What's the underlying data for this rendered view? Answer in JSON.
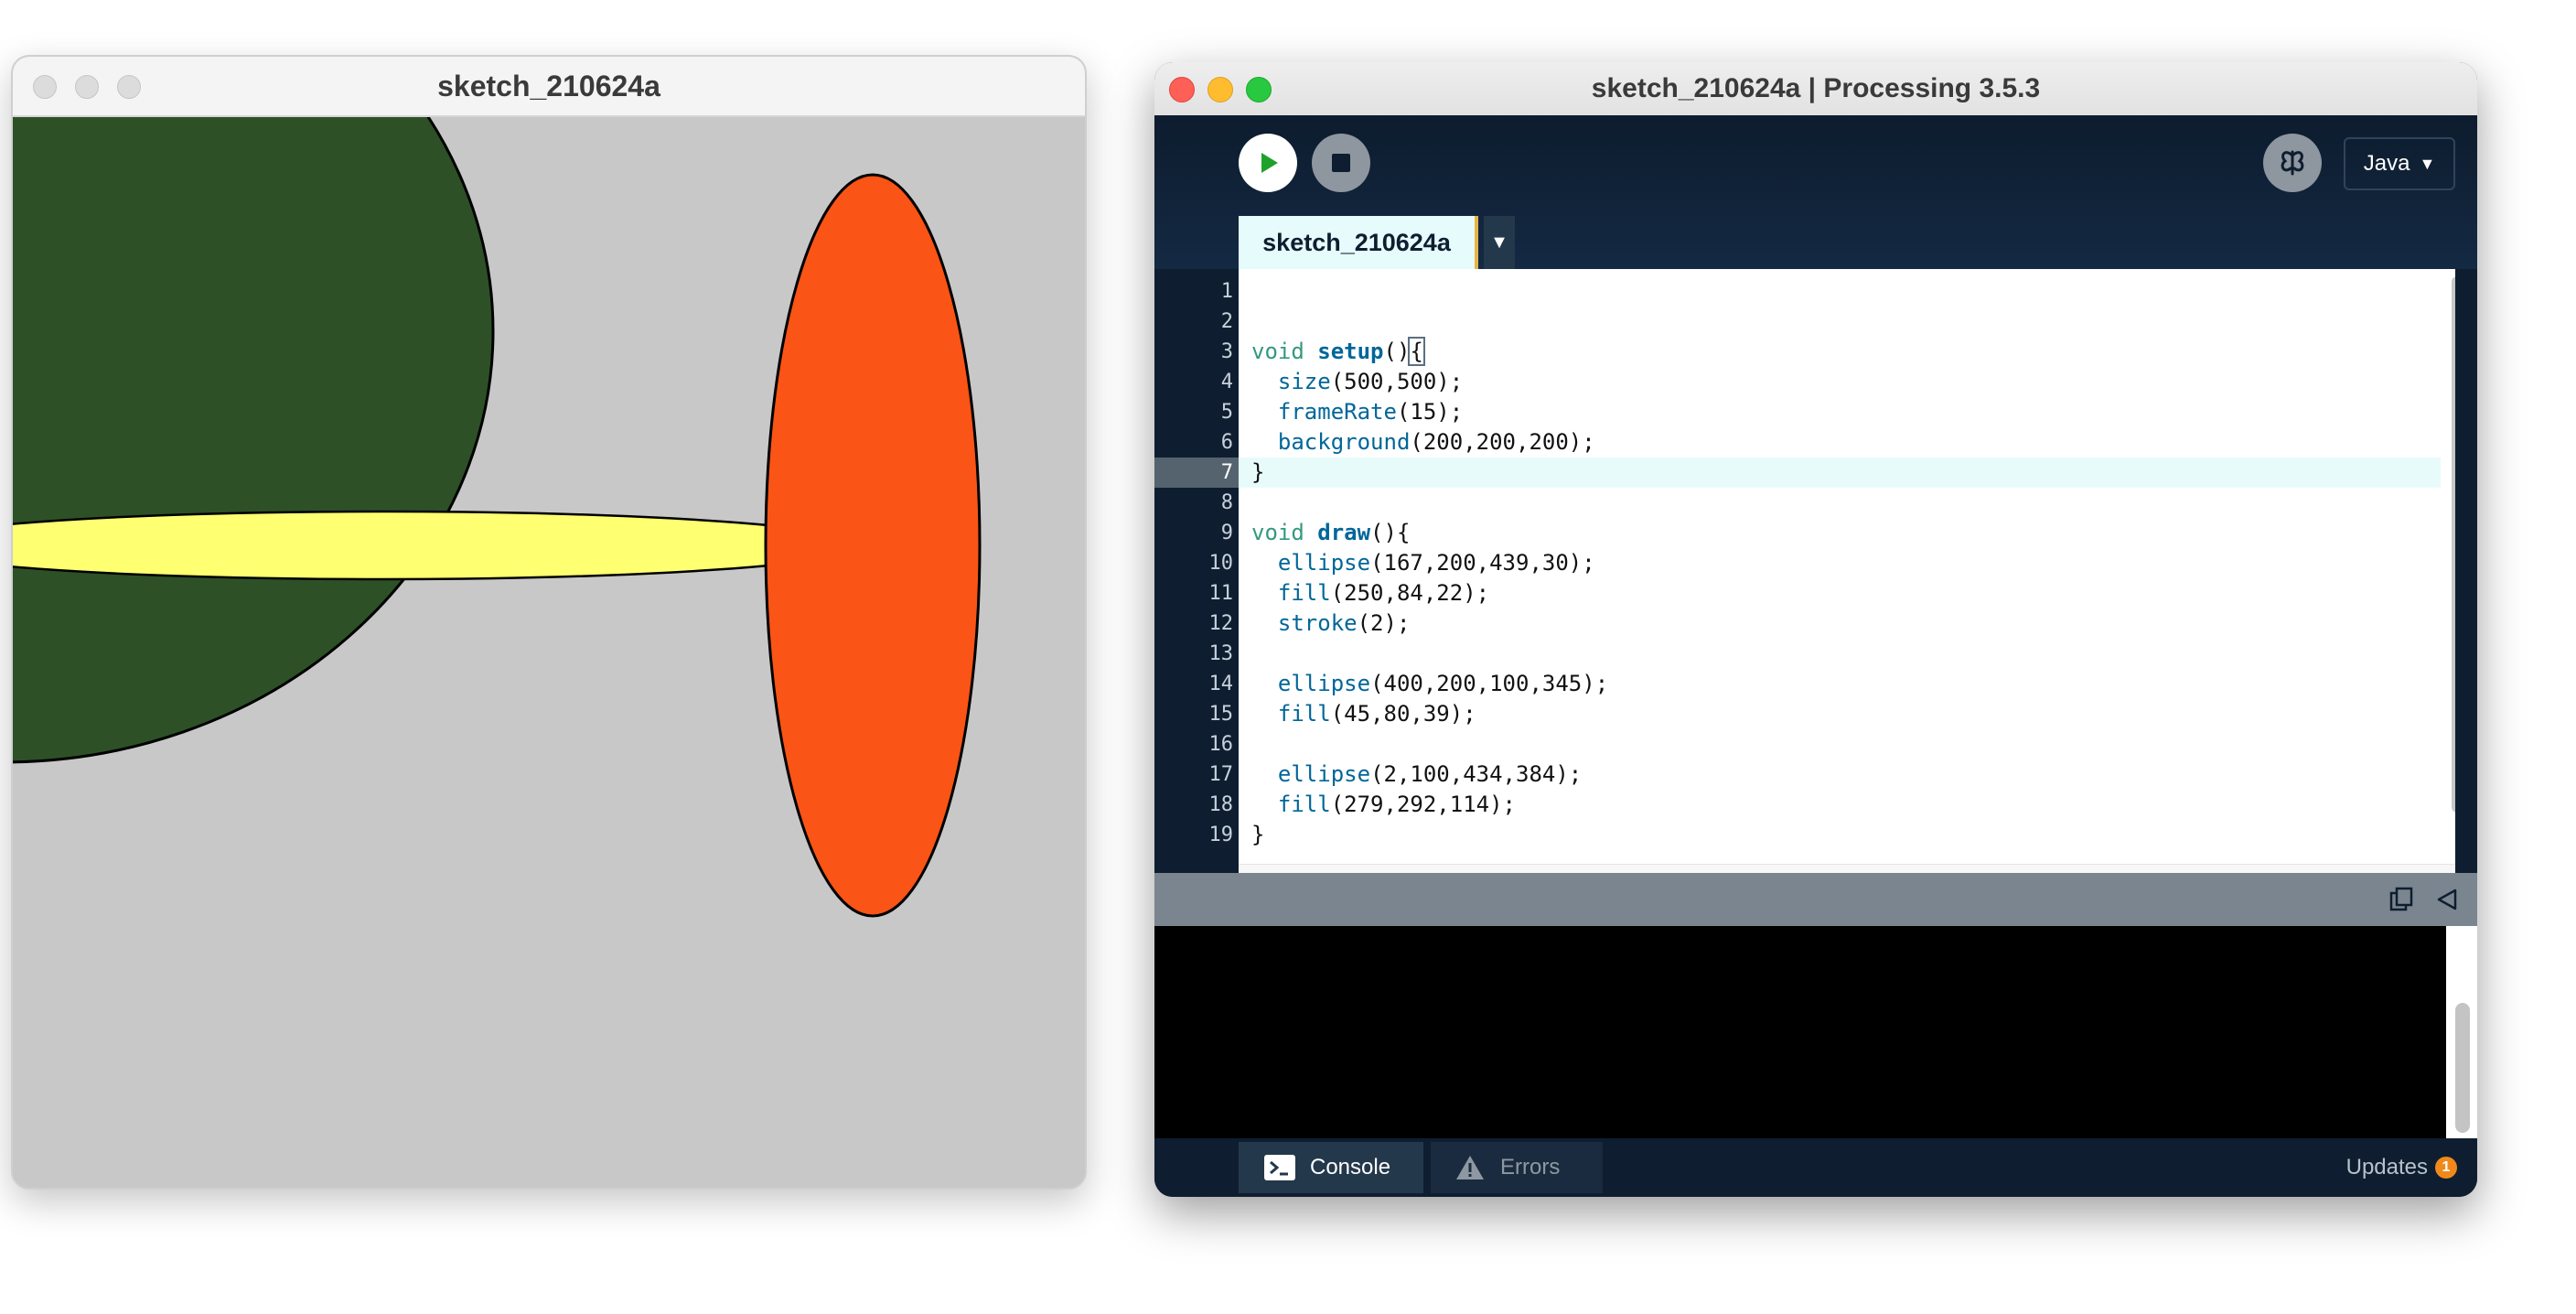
{
  "sketch_window": {
    "title": "sketch_210624a"
  },
  "ide_window": {
    "title": "sketch_210624a | Processing 3.5.3",
    "mode": "Java",
    "tab_label": "sketch_210624a",
    "code": [
      {
        "num": "1",
        "text": ""
      },
      {
        "num": "2",
        "text": ""
      },
      {
        "num": "3",
        "text": "void setup(){"
      },
      {
        "num": "4",
        "text": "  size(500,500);"
      },
      {
        "num": "5",
        "text": "  frameRate(15);"
      },
      {
        "num": "6",
        "text": "  background(200,200,200);"
      },
      {
        "num": "7",
        "text": "}"
      },
      {
        "num": "8",
        "text": ""
      },
      {
        "num": "9",
        "text": "void draw(){"
      },
      {
        "num": "10",
        "text": "  ellipse(167,200,439,30);"
      },
      {
        "num": "11",
        "text": "  fill(250,84,22);"
      },
      {
        "num": "12",
        "text": "  stroke(2);"
      },
      {
        "num": "13",
        "text": ""
      },
      {
        "num": "14",
        "text": "  ellipse(400,200,100,345);"
      },
      {
        "num": "15",
        "text": "  fill(45,80,39);"
      },
      {
        "num": "16",
        "text": ""
      },
      {
        "num": "17",
        "text": "  ellipse(2,100,434,384);"
      },
      {
        "num": "18",
        "text": "  fill(279,292,114);"
      },
      {
        "num": "19",
        "text": "}"
      }
    ],
    "current_line": "7",
    "console_tab_label": "Console",
    "errors_tab_label": "Errors",
    "updates_label": "Updates",
    "updates_count": "1"
  },
  "colors": {
    "canvas_bg": "#c8c8c8",
    "dark_green": "#2d5027",
    "orange": "#fa5416",
    "yellow": "#ffff72",
    "ide_dark": "#0e1e30"
  }
}
